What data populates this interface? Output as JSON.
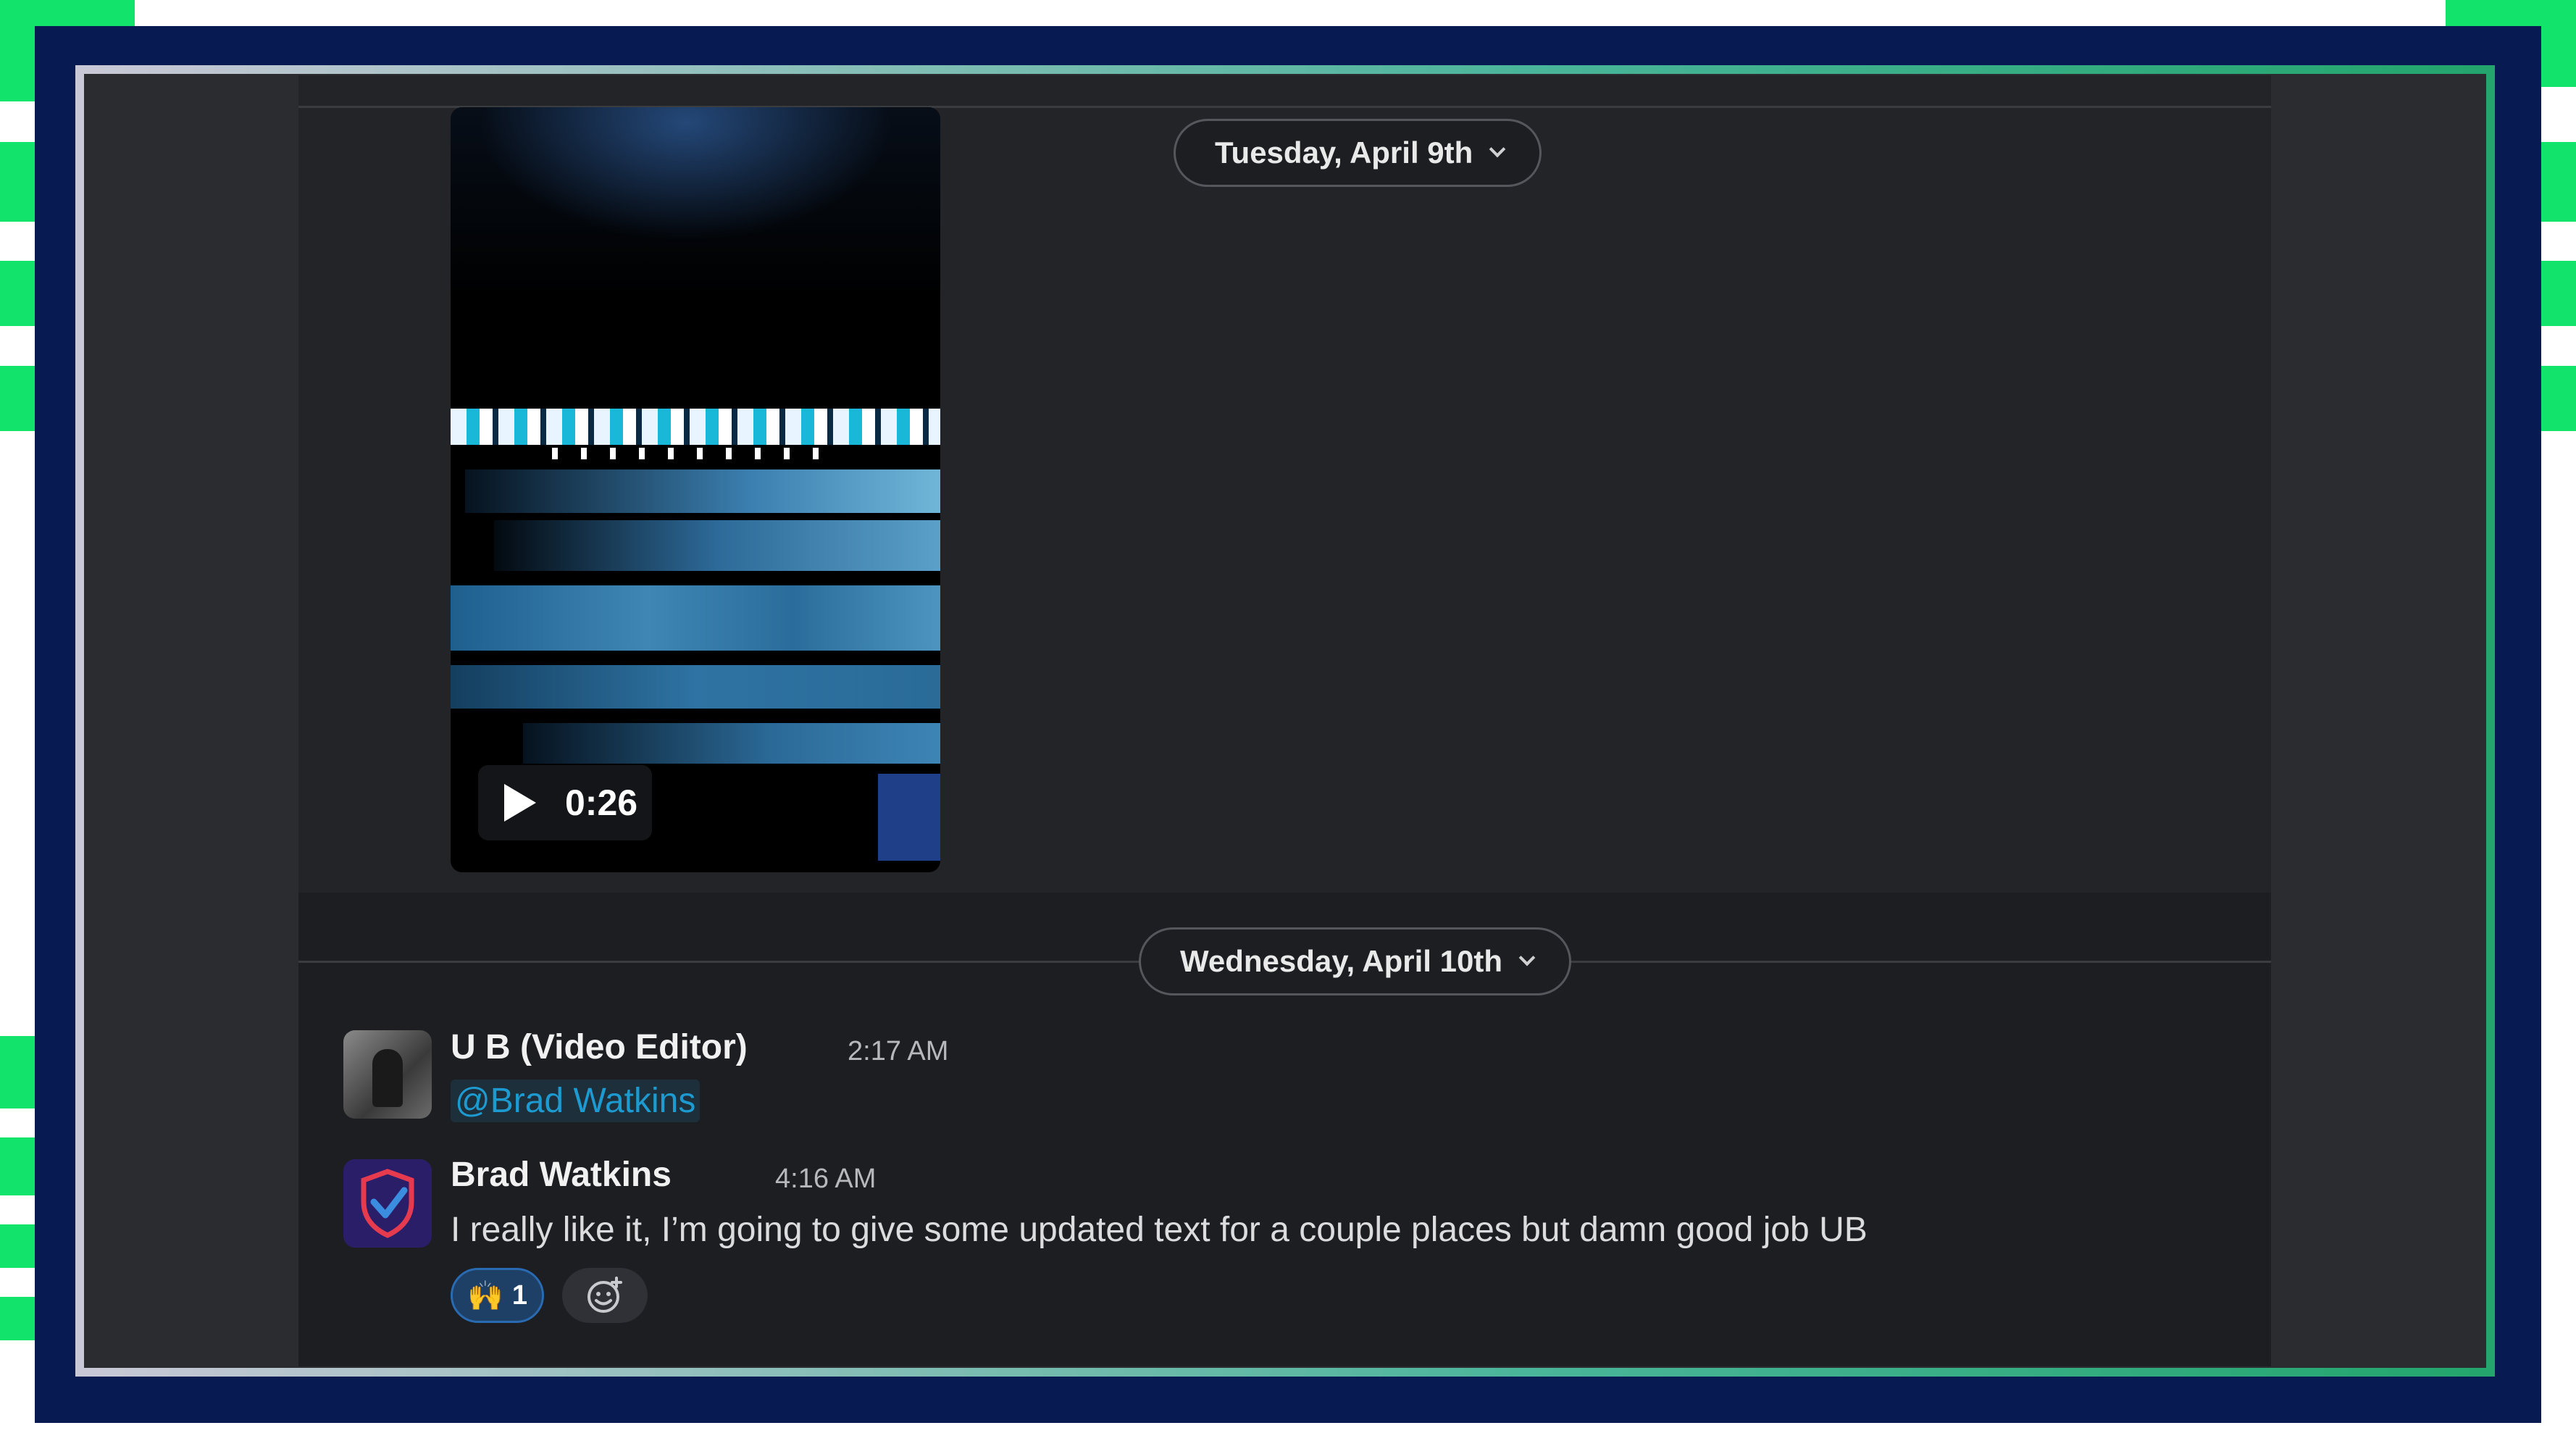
{
  "video": {
    "duration": "0:26"
  },
  "dates": {
    "first": "Tuesday, April 9th",
    "second": "Wednesday, April 10th"
  },
  "messages": [
    {
      "author": "U B (Video Editor)",
      "time": "2:17 AM",
      "mention": "@Brad Watkins"
    },
    {
      "author": "Brad Watkins",
      "time": "4:16 AM",
      "text": "I really like it, I’m going to give some updated text for a couple places but damn good job UB"
    }
  ],
  "reactions": [
    {
      "emoji": "🙌",
      "count": "1",
      "icon": "raised-hands-icon"
    },
    {
      "icon": "add-reaction-icon"
    }
  ],
  "colors": {
    "mention": "#1d9bd1",
    "frame": "#081a52",
    "accent": "#12e46b"
  }
}
